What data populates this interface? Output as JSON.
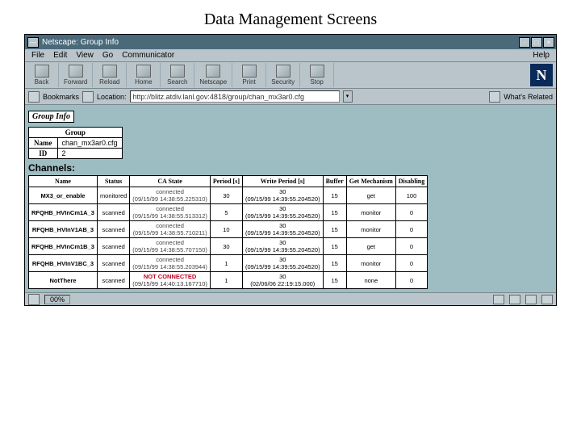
{
  "page_title": "Data Management Screens",
  "window_title": "Netscape: Group Info",
  "menu": [
    "File",
    "Edit",
    "View",
    "Go",
    "Communicator"
  ],
  "menu_help": "Help",
  "toolbar": {
    "back": "Back",
    "forward": "Forward",
    "reload": "Reload",
    "home": "Home",
    "search": "Search",
    "netscape": "Netscape",
    "print": "Print",
    "security": "Security",
    "stop": "Stop"
  },
  "location": {
    "bookmarks": "Bookmarks",
    "label": "Location:",
    "url": "http://blitz.atdiv.lanl.gov:4818/group/chan_mx3ar0.cfg",
    "related": "What's Related"
  },
  "group_header": "Group Info",
  "info": {
    "group_label": "Group",
    "name_label": "Name",
    "name_value": "chan_mx3ar0.cfg",
    "id_label": "ID",
    "id_value": "2"
  },
  "channels_header": "Channels:",
  "ch_headers": [
    "Name",
    "Status",
    "CA State",
    "Period [s]",
    "Write Period [s]",
    "Buffer",
    "Get Mechanism",
    "Disabling"
  ],
  "channels": [
    {
      "name": "MX3_or_enable",
      "status": "monitored",
      "cas": "connected\n(09/15/99 14:38:55.225310)",
      "period": "30",
      "write": "30\n(09/15/99 14:39:55.204520)",
      "buffer": "15",
      "mech": "get",
      "dis": "100"
    },
    {
      "name": "RFQHB_HVInCm1A_3",
      "status": "scanned",
      "cas": "connected\n(09/15/99 14:38:55.513312)",
      "period": "5",
      "write": "30\n(09/15/99 14:39:55.204520)",
      "buffer": "15",
      "mech": "monitor",
      "dis": "0"
    },
    {
      "name": "RFQHB_HVInV1AB_3",
      "status": "scanned",
      "cas": "connected\n(09/15/99 14:38:55.710211)",
      "period": "10",
      "write": "30\n(09/15/99 14:39:55.204520)",
      "buffer": "15",
      "mech": "monitor",
      "dis": "0"
    },
    {
      "name": "RFQHB_HVInCm1B_3",
      "status": "scanned",
      "cas": "connected\n(09/15/99 14:38:55.707150)",
      "period": "30",
      "write": "30\n(09/15/99 14:39:55.204520)",
      "buffer": "15",
      "mech": "get",
      "dis": "0"
    },
    {
      "name": "RFQHB_HVInV1BC_3",
      "status": "scanned",
      "cas": "connected\n(09/15/99 14:38:55.203944)",
      "period": "1",
      "write": "30\n(09/15/99 14:39:55.204520)",
      "buffer": "15",
      "mech": "monitor",
      "dis": "0"
    },
    {
      "name": "NotThere",
      "status": "scanned",
      "cas_err": "NOT CONNECTED",
      "cas_ts": "(09/15/99 14:40:13.167710)",
      "period": "1",
      "write": "30\n(02/06/06 22:19:15.000)",
      "buffer": "15",
      "mech": "none",
      "dis": "0"
    }
  ],
  "status": {
    "percent": "00%"
  }
}
